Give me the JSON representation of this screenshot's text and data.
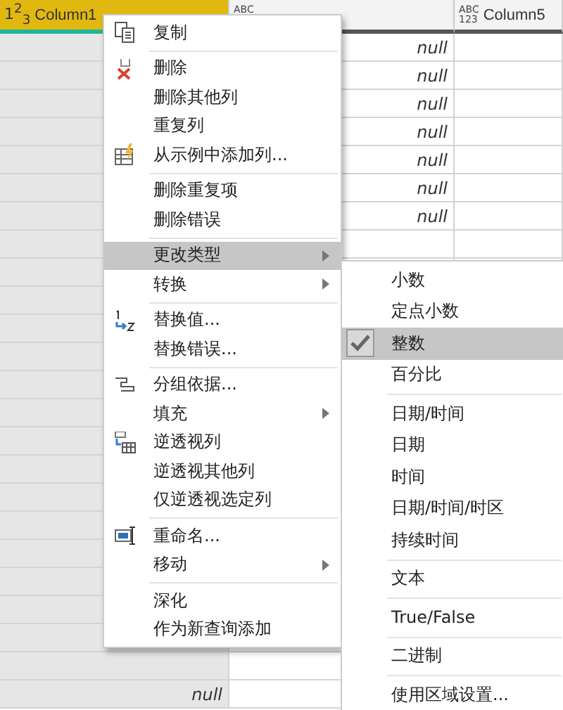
{
  "table": {
    "columns": [
      {
        "type_label": "1$^{2}$$_{3}$",
        "name": "Column1",
        "selected": true
      },
      {
        "type_label": "ABC",
        "selected": false
      },
      {
        "type_label": "ABC\n123",
        "name": "Column5",
        "selected": false
      }
    ],
    "rows": [
      [
        "",
        "null",
        ""
      ],
      [
        "",
        "null",
        ""
      ],
      [
        "",
        "null",
        ""
      ],
      [
        "",
        "null",
        ""
      ],
      [
        "",
        "null",
        ""
      ],
      [
        "",
        "null",
        ""
      ],
      [
        "",
        "null",
        ""
      ],
      [
        "",
        "",
        ""
      ],
      [
        "",
        "",
        ""
      ],
      [
        "",
        "",
        ""
      ],
      [
        "",
        "",
        ""
      ],
      [
        "",
        "",
        ""
      ],
      [
        "",
        "",
        ""
      ],
      [
        "",
        "",
        ""
      ],
      [
        "",
        "",
        ""
      ],
      [
        "",
        "",
        ""
      ],
      [
        "",
        "",
        ""
      ],
      [
        "",
        "",
        ""
      ],
      [
        "",
        "",
        ""
      ],
      [
        "",
        "",
        ""
      ],
      [
        "",
        "",
        ""
      ],
      [
        "",
        "",
        ""
      ],
      [
        "",
        "",
        ""
      ],
      [
        "null",
        "",
        ""
      ]
    ]
  },
  "context_menu": {
    "groups": [
      [
        {
          "label": "复制",
          "kind": "copy",
          "highlighted": false
        }
      ],
      [
        {
          "label": "删除",
          "kind": "delete",
          "highlighted": false
        },
        {
          "label": "删除其他列",
          "highlighted": false
        },
        {
          "label": "重复列",
          "highlighted": false
        },
        {
          "label": "从示例中添加列...",
          "kind": "example",
          "highlighted": false
        }
      ],
      [
        {
          "label": "删除重复项",
          "highlighted": false
        },
        {
          "label": "删除错误",
          "highlighted": false
        }
      ],
      [
        {
          "label": "更改类型",
          "submenu": true,
          "highlighted": true
        },
        {
          "label": "转换",
          "submenu": true,
          "highlighted": false
        }
      ],
      [
        {
          "label": "替换值...",
          "kind": "replace",
          "highlighted": false
        },
        {
          "label": "替换错误...",
          "highlighted": false
        }
      ],
      [
        {
          "label": "分组依据...",
          "kind": "group",
          "highlighted": false
        },
        {
          "label": "填充",
          "submenu": true,
          "highlighted": false
        },
        {
          "label": "逆透视列",
          "kind": "unpivot",
          "highlighted": false
        },
        {
          "label": "逆透视其他列",
          "highlighted": false
        },
        {
          "label": "仅逆透视选定列",
          "highlighted": false
        }
      ],
      [
        {
          "label": "重命名...",
          "kind": "rename",
          "highlighted": false
        },
        {
          "label": "移动",
          "submenu": true,
          "highlighted": false
        }
      ],
      [
        {
          "label": "深化",
          "highlighted": false
        },
        {
          "label": "作为新查询添加",
          "highlighted": false
        }
      ]
    ]
  },
  "type_submenu": {
    "groups": [
      [
        {
          "label": "小数",
          "selected": false
        },
        {
          "label": "定点小数",
          "selected": false
        },
        {
          "label": "整数",
          "selected": true
        },
        {
          "label": "百分比",
          "selected": false
        }
      ],
      [
        {
          "label": "日期/时间",
          "selected": false
        },
        {
          "label": "日期",
          "selected": false
        },
        {
          "label": "时间",
          "selected": false
        },
        {
          "label": "日期/时间/时区",
          "selected": false
        },
        {
          "label": "持续时间",
          "selected": false
        }
      ],
      [
        {
          "label": "文本",
          "selected": false
        }
      ],
      [
        {
          "label": "True/False",
          "selected": false
        }
      ],
      [
        {
          "label": "二进制",
          "selected": false
        }
      ],
      [
        {
          "label": "使用区域设置...",
          "selected": false
        }
      ]
    ]
  }
}
